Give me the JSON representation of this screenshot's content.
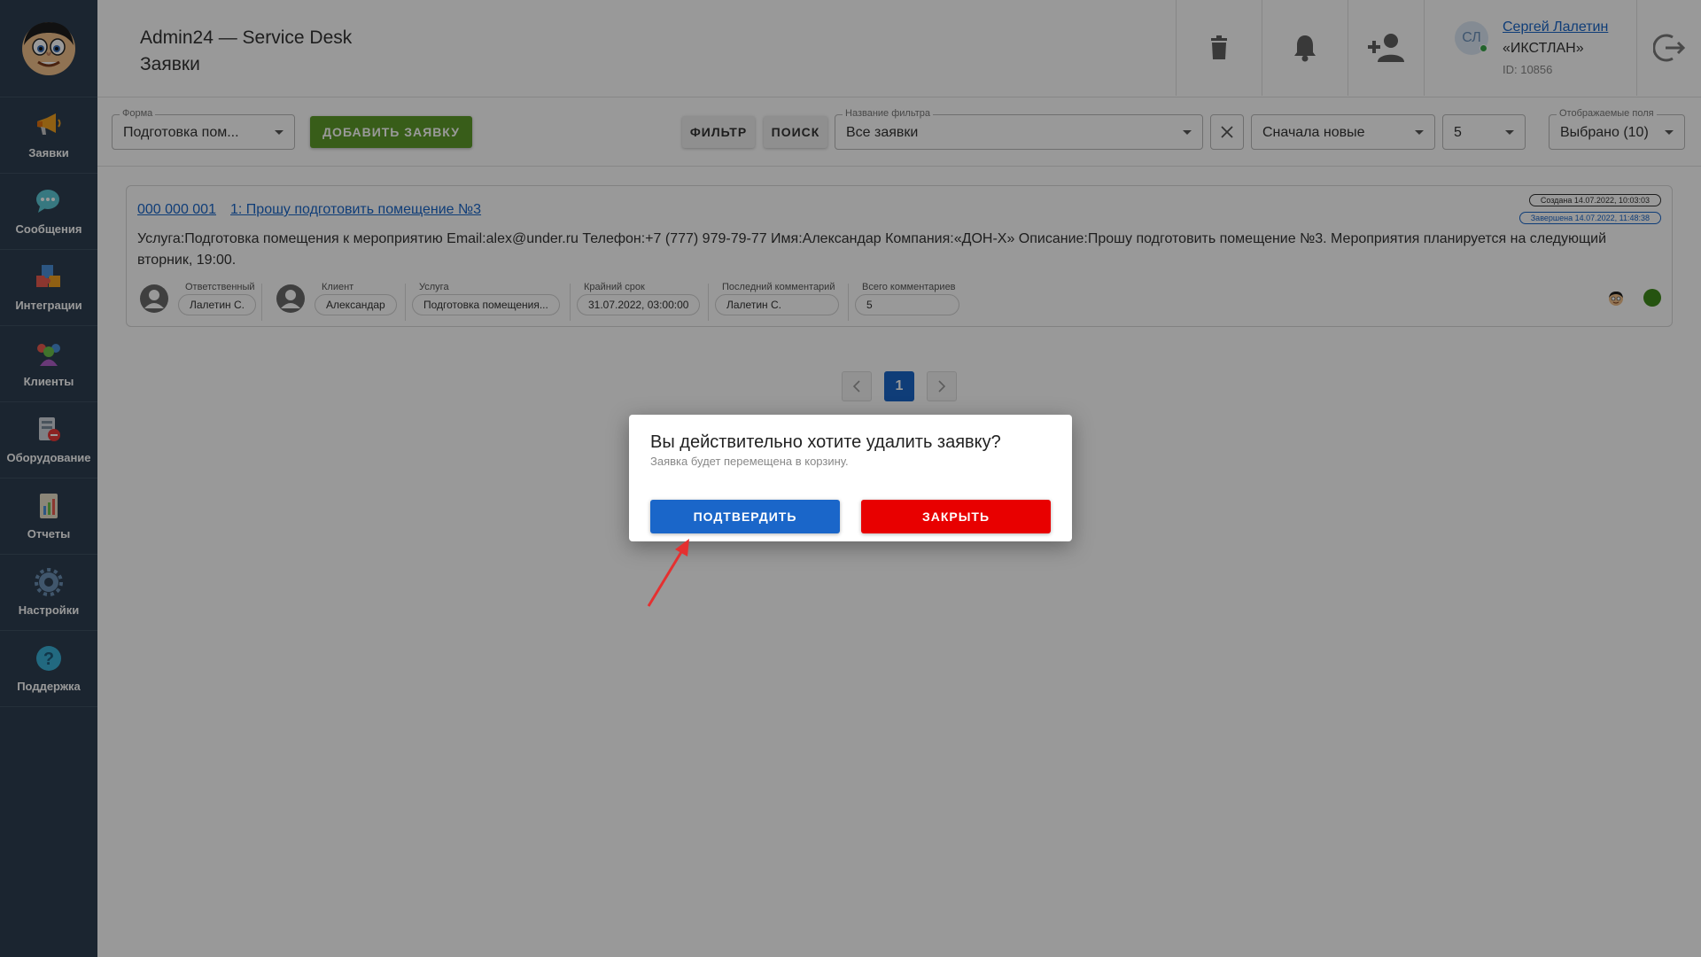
{
  "colors": {
    "sidebar_bg": "#2d3f50",
    "accent_blue": "#1a66c9",
    "add_green": "#5e9c2a",
    "close_red": "#e80000",
    "status_green": "#3f8a1c"
  },
  "sidebar": {
    "items": [
      {
        "label": "Заявки",
        "icon": "megaphone-icon"
      },
      {
        "label": "Сообщения",
        "icon": "chat-bubble-icon"
      },
      {
        "label": "Интеграции",
        "icon": "puzzle-icon"
      },
      {
        "label": "Клиенты",
        "icon": "people-icon"
      },
      {
        "label": "Оборудование",
        "icon": "equipment-icon"
      },
      {
        "label": "Отчеты",
        "icon": "report-icon"
      },
      {
        "label": "Настройки",
        "icon": "gear-icon"
      },
      {
        "label": "Поддержка",
        "icon": "help-icon"
      }
    ]
  },
  "header": {
    "app_title": "Admin24 — Service Desk",
    "page_title": "Заявки",
    "user": {
      "initials": "СЛ",
      "name": "Сергей Лалетин",
      "company": "«ИКСТЛАН»",
      "id": "ID: 10856"
    }
  },
  "toolbar": {
    "form_label": "Форма",
    "form_value": "Подготовка пом...",
    "add_button": "ДОБАВИТЬ ЗАЯВКУ",
    "filter_button": "ФИЛЬТР",
    "search_button": "ПОИСК",
    "filter_name_label": "Название фильтра",
    "filter_name_value": "Все заявки",
    "sort_value": "Сначала новые",
    "per_page_value": "5",
    "fields_label": "Отображаемые поля",
    "fields_value": "Выбрано (10)"
  },
  "ticket": {
    "number": "000 000 001",
    "title": "1: Прошу подготовить помещение №3",
    "description": "Услуга:Подготовка помещения к мероприятию Email:alex@under.ru Телефон:+7 (777) 979-79-77 Имя:Александар Компания:«ДОН-Х» Описание:Прошу подготовить помещение №3. Мероприятия планируется на следующий вторник, 19:00.",
    "created": "Создана 14.07.2022, 10:03:03",
    "completed": "Завершена 14.07.2022, 11:48:38",
    "responsible_label": "Ответственный",
    "responsible_value": "Лалетин С.",
    "client_label": "Клиент",
    "client_value": "Александар",
    "service_label": "Услуга",
    "service_value": "Подготовка помещения...",
    "deadline_label": "Крайний срок",
    "deadline_value": "31.07.2022, 03:00:00",
    "last_comment_label": "Последний комментарий",
    "last_comment_value": "Лалетин С.",
    "total_comments_label": "Всего комментариев",
    "total_comments_value": "5"
  },
  "pagination": {
    "current": "1"
  },
  "dialog": {
    "title": "Вы действительно хотите удалить заявку?",
    "subtitle": "Заявка будет перемещена в корзину.",
    "confirm": "ПОДТВЕРДИТЬ",
    "close": "ЗАКРЫТЬ"
  }
}
